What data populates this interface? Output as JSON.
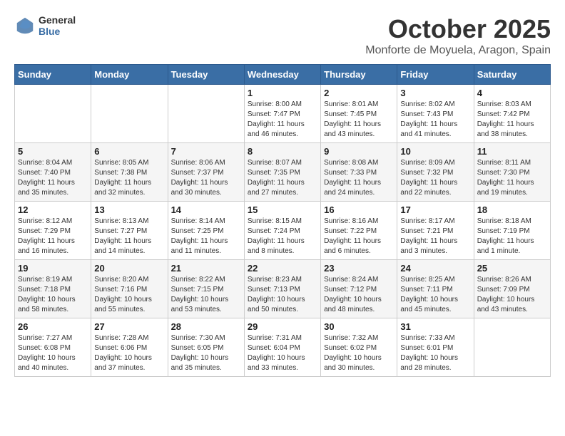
{
  "header": {
    "logo": {
      "general": "General",
      "blue": "Blue"
    },
    "title": "October 2025",
    "location": "Monforte de Moyuela, Aragon, Spain"
  },
  "weekdays": [
    "Sunday",
    "Monday",
    "Tuesday",
    "Wednesday",
    "Thursday",
    "Friday",
    "Saturday"
  ],
  "weeks": [
    [
      {
        "day": "",
        "info": ""
      },
      {
        "day": "",
        "info": ""
      },
      {
        "day": "",
        "info": ""
      },
      {
        "day": "1",
        "info": "Sunrise: 8:00 AM\nSunset: 7:47 PM\nDaylight: 11 hours\nand 46 minutes."
      },
      {
        "day": "2",
        "info": "Sunrise: 8:01 AM\nSunset: 7:45 PM\nDaylight: 11 hours\nand 43 minutes."
      },
      {
        "day": "3",
        "info": "Sunrise: 8:02 AM\nSunset: 7:43 PM\nDaylight: 11 hours\nand 41 minutes."
      },
      {
        "day": "4",
        "info": "Sunrise: 8:03 AM\nSunset: 7:42 PM\nDaylight: 11 hours\nand 38 minutes."
      }
    ],
    [
      {
        "day": "5",
        "info": "Sunrise: 8:04 AM\nSunset: 7:40 PM\nDaylight: 11 hours\nand 35 minutes."
      },
      {
        "day": "6",
        "info": "Sunrise: 8:05 AM\nSunset: 7:38 PM\nDaylight: 11 hours\nand 32 minutes."
      },
      {
        "day": "7",
        "info": "Sunrise: 8:06 AM\nSunset: 7:37 PM\nDaylight: 11 hours\nand 30 minutes."
      },
      {
        "day": "8",
        "info": "Sunrise: 8:07 AM\nSunset: 7:35 PM\nDaylight: 11 hours\nand 27 minutes."
      },
      {
        "day": "9",
        "info": "Sunrise: 8:08 AM\nSunset: 7:33 PM\nDaylight: 11 hours\nand 24 minutes."
      },
      {
        "day": "10",
        "info": "Sunrise: 8:09 AM\nSunset: 7:32 PM\nDaylight: 11 hours\nand 22 minutes."
      },
      {
        "day": "11",
        "info": "Sunrise: 8:11 AM\nSunset: 7:30 PM\nDaylight: 11 hours\nand 19 minutes."
      }
    ],
    [
      {
        "day": "12",
        "info": "Sunrise: 8:12 AM\nSunset: 7:29 PM\nDaylight: 11 hours\nand 16 minutes."
      },
      {
        "day": "13",
        "info": "Sunrise: 8:13 AM\nSunset: 7:27 PM\nDaylight: 11 hours\nand 14 minutes."
      },
      {
        "day": "14",
        "info": "Sunrise: 8:14 AM\nSunset: 7:25 PM\nDaylight: 11 hours\nand 11 minutes."
      },
      {
        "day": "15",
        "info": "Sunrise: 8:15 AM\nSunset: 7:24 PM\nDaylight: 11 hours\nand 8 minutes."
      },
      {
        "day": "16",
        "info": "Sunrise: 8:16 AM\nSunset: 7:22 PM\nDaylight: 11 hours\nand 6 minutes."
      },
      {
        "day": "17",
        "info": "Sunrise: 8:17 AM\nSunset: 7:21 PM\nDaylight: 11 hours\nand 3 minutes."
      },
      {
        "day": "18",
        "info": "Sunrise: 8:18 AM\nSunset: 7:19 PM\nDaylight: 11 hours\nand 1 minute."
      }
    ],
    [
      {
        "day": "19",
        "info": "Sunrise: 8:19 AM\nSunset: 7:18 PM\nDaylight: 10 hours\nand 58 minutes."
      },
      {
        "day": "20",
        "info": "Sunrise: 8:20 AM\nSunset: 7:16 PM\nDaylight: 10 hours\nand 55 minutes."
      },
      {
        "day": "21",
        "info": "Sunrise: 8:22 AM\nSunset: 7:15 PM\nDaylight: 10 hours\nand 53 minutes."
      },
      {
        "day": "22",
        "info": "Sunrise: 8:23 AM\nSunset: 7:13 PM\nDaylight: 10 hours\nand 50 minutes."
      },
      {
        "day": "23",
        "info": "Sunrise: 8:24 AM\nSunset: 7:12 PM\nDaylight: 10 hours\nand 48 minutes."
      },
      {
        "day": "24",
        "info": "Sunrise: 8:25 AM\nSunset: 7:11 PM\nDaylight: 10 hours\nand 45 minutes."
      },
      {
        "day": "25",
        "info": "Sunrise: 8:26 AM\nSunset: 7:09 PM\nDaylight: 10 hours\nand 43 minutes."
      }
    ],
    [
      {
        "day": "26",
        "info": "Sunrise: 7:27 AM\nSunset: 6:08 PM\nDaylight: 10 hours\nand 40 minutes."
      },
      {
        "day": "27",
        "info": "Sunrise: 7:28 AM\nSunset: 6:06 PM\nDaylight: 10 hours\nand 37 minutes."
      },
      {
        "day": "28",
        "info": "Sunrise: 7:30 AM\nSunset: 6:05 PM\nDaylight: 10 hours\nand 35 minutes."
      },
      {
        "day": "29",
        "info": "Sunrise: 7:31 AM\nSunset: 6:04 PM\nDaylight: 10 hours\nand 33 minutes."
      },
      {
        "day": "30",
        "info": "Sunrise: 7:32 AM\nSunset: 6:02 PM\nDaylight: 10 hours\nand 30 minutes."
      },
      {
        "day": "31",
        "info": "Sunrise: 7:33 AM\nSunset: 6:01 PM\nDaylight: 10 hours\nand 28 minutes."
      },
      {
        "day": "",
        "info": ""
      }
    ]
  ]
}
